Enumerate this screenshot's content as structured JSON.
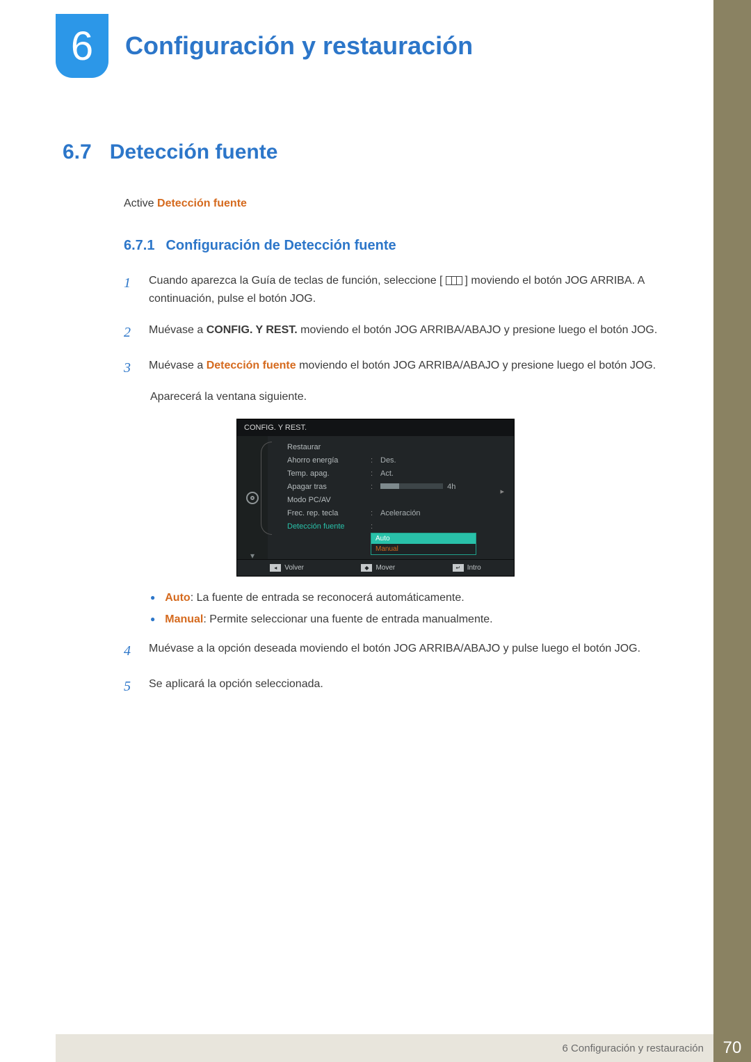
{
  "chapter": {
    "num": "6",
    "title": "Configuración y restauración"
  },
  "section": {
    "num": "6.7",
    "title": "Detección fuente"
  },
  "intro": {
    "pre": "Active ",
    "em": "Detección fuente"
  },
  "subsection": {
    "num": "6.7.1",
    "title": "Configuración de Detección fuente"
  },
  "steps": {
    "1": {
      "num": "1",
      "a": "Cuando aparezca la Guía de teclas de función, seleccione [",
      "b": "] moviendo el botón JOG ARRIBA. A continuación, pulse el botón JOG."
    },
    "2": {
      "num": "2",
      "a": "Muévase a ",
      "strong": "CONFIG. Y REST.",
      "b": " moviendo el botón JOG ARRIBA/ABAJO y presione luego el botón JOG."
    },
    "3": {
      "num": "3",
      "a": "Muévase a ",
      "em": "Detección fuente",
      "b": " moviendo el botón JOG ARRIBA/ABAJO y presione luego el botón JOG.",
      "trail": "Aparecerá la ventana siguiente."
    },
    "4": {
      "num": "4",
      "text": "Muévase a la opción deseada moviendo el botón JOG ARRIBA/ABAJO y pulse luego el botón JOG."
    },
    "5": {
      "num": "5",
      "text": "Se aplicará la opción seleccionada."
    }
  },
  "osd": {
    "title": "CONFIG. Y REST.",
    "rows": {
      "restaurar": "Restaurar",
      "ahorro": "Ahorro energía",
      "ahorro_val": "Des.",
      "temp": "Temp. apag.",
      "temp_val": "Act.",
      "apagar": "Apagar tras",
      "apagar_val": "4h",
      "modo": "Modo PC/AV",
      "frec": "Frec. rep. tecla",
      "frec_val": "Aceleración",
      "src": "Detección fuente",
      "src_opt1": "Auto",
      "src_opt2": "Manual"
    },
    "footer": {
      "volver": "Volver",
      "mover": "Mover",
      "intro": "Intro"
    }
  },
  "bullets": {
    "auto_key": "Auto",
    "auto_text": ": La fuente de entrada se reconocerá automáticamente.",
    "manual_key": "Manual",
    "manual_text": ": Permite seleccionar una fuente de entrada manualmente."
  },
  "footer": {
    "text": "6 Configuración y restauración",
    "page": "70"
  }
}
